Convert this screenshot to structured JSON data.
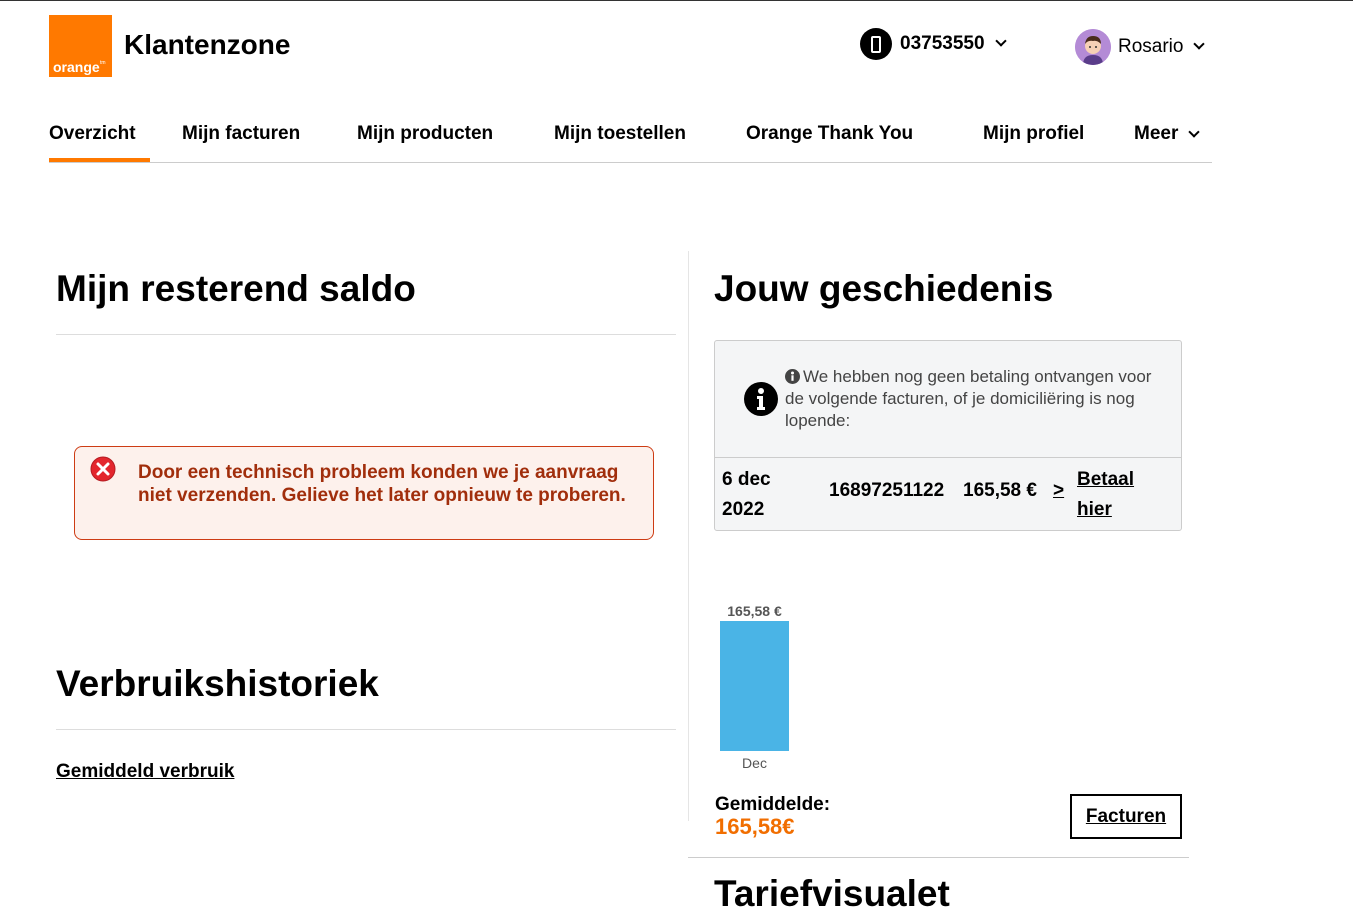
{
  "header": {
    "logo_text": "orange",
    "logo_tm": "tm",
    "app_title": "Klantenzone",
    "phone_number": "03753550",
    "user_name": "Rosario"
  },
  "nav": {
    "items": [
      {
        "label": "Overzicht",
        "active": true
      },
      {
        "label": "Mijn facturen"
      },
      {
        "label": "Mijn producten"
      },
      {
        "label": "Mijn toestellen"
      },
      {
        "label": "Orange Thank You"
      },
      {
        "label": "Mijn profiel"
      },
      {
        "label": "Meer"
      }
    ]
  },
  "balance": {
    "title": "Mijn resterend saldo",
    "error_message": "Door een technisch probleem konden we je aanvraag niet verzenden. Gelieve het later opnieuw te proberen."
  },
  "usage": {
    "title": "Verbruikshistoriek",
    "avg_link": "Gemiddeld verbruik"
  },
  "history": {
    "title": "Jouw geschiedenis",
    "info_message": "We hebben nog geen betaling ontvangen voor de volgende facturen, of je domiciliëring is nog lopende:",
    "invoice": {
      "date": "6 dec 2022",
      "number": "16897251122",
      "amount": "165,58 €",
      "arrow": ">",
      "pay_link": "Betaal hier"
    },
    "avg_label": "Gemiddelde:",
    "avg_value": "165,58€",
    "invoices_button": "Facturen",
    "next_section_title": "Tariefvisualet"
  },
  "chart_data": {
    "type": "bar",
    "categories": [
      "Dec"
    ],
    "values": [
      165.58
    ],
    "data_labels": [
      "165,58 €"
    ],
    "title": "",
    "xlabel": "",
    "ylabel": "",
    "bar_color": "#4ab4e6"
  },
  "colors": {
    "brand_orange": "#ff7900",
    "error_text": "#a12e0c",
    "error_border": "#cd3c14",
    "avg_value": "#f16e00"
  }
}
